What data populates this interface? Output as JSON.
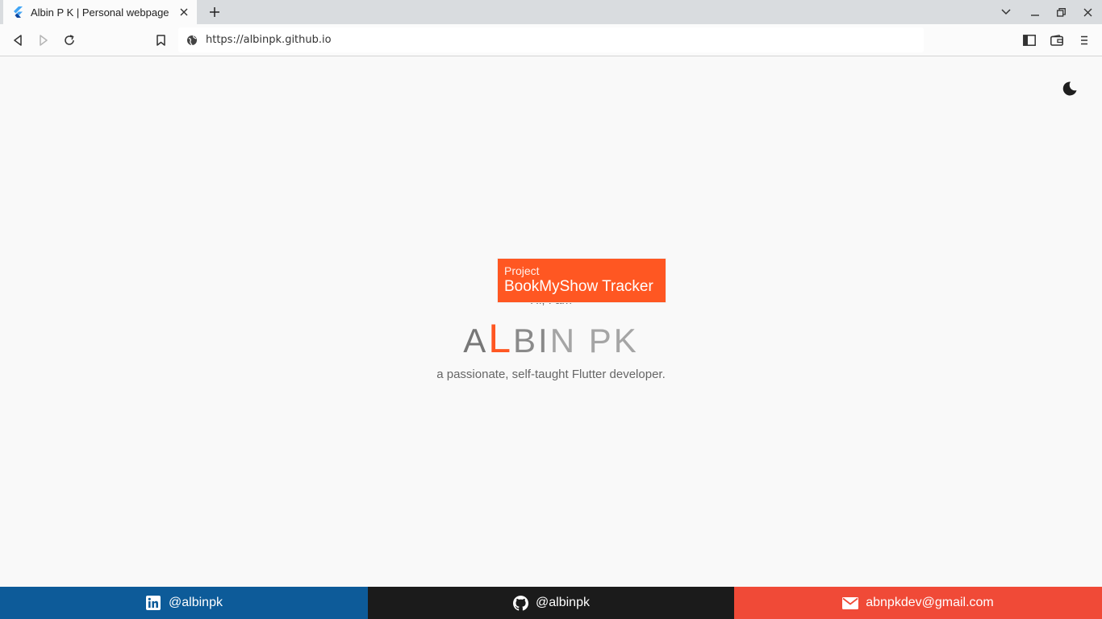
{
  "browser": {
    "tab": {
      "title": "Albin P K | Personal webpage",
      "favicon": "flutter-icon"
    },
    "url": "https://albinpk.github.io"
  },
  "hero": {
    "greeting": "Hi, I am",
    "name": {
      "part1": "A",
      "highlight": "L",
      "part2": "BI",
      "part3": "N PK"
    },
    "tagline": "a passionate, self-taught Flutter developer.",
    "accent_color": "#ff5722"
  },
  "tooltip": {
    "kind": "Project",
    "name": "BookMyShow Tracker"
  },
  "footer": {
    "linkedin": {
      "label": "@albinpk",
      "icon": "linkedin-icon",
      "color": "#0d5b99"
    },
    "github": {
      "label": "@albinpk",
      "icon": "github-icon",
      "color": "#1b1b1b"
    },
    "email": {
      "label": "abnpkdev@gmail.com",
      "icon": "mail-icon",
      "color": "#f04a37"
    }
  },
  "theme_toggle": {
    "icon": "moon-icon"
  }
}
